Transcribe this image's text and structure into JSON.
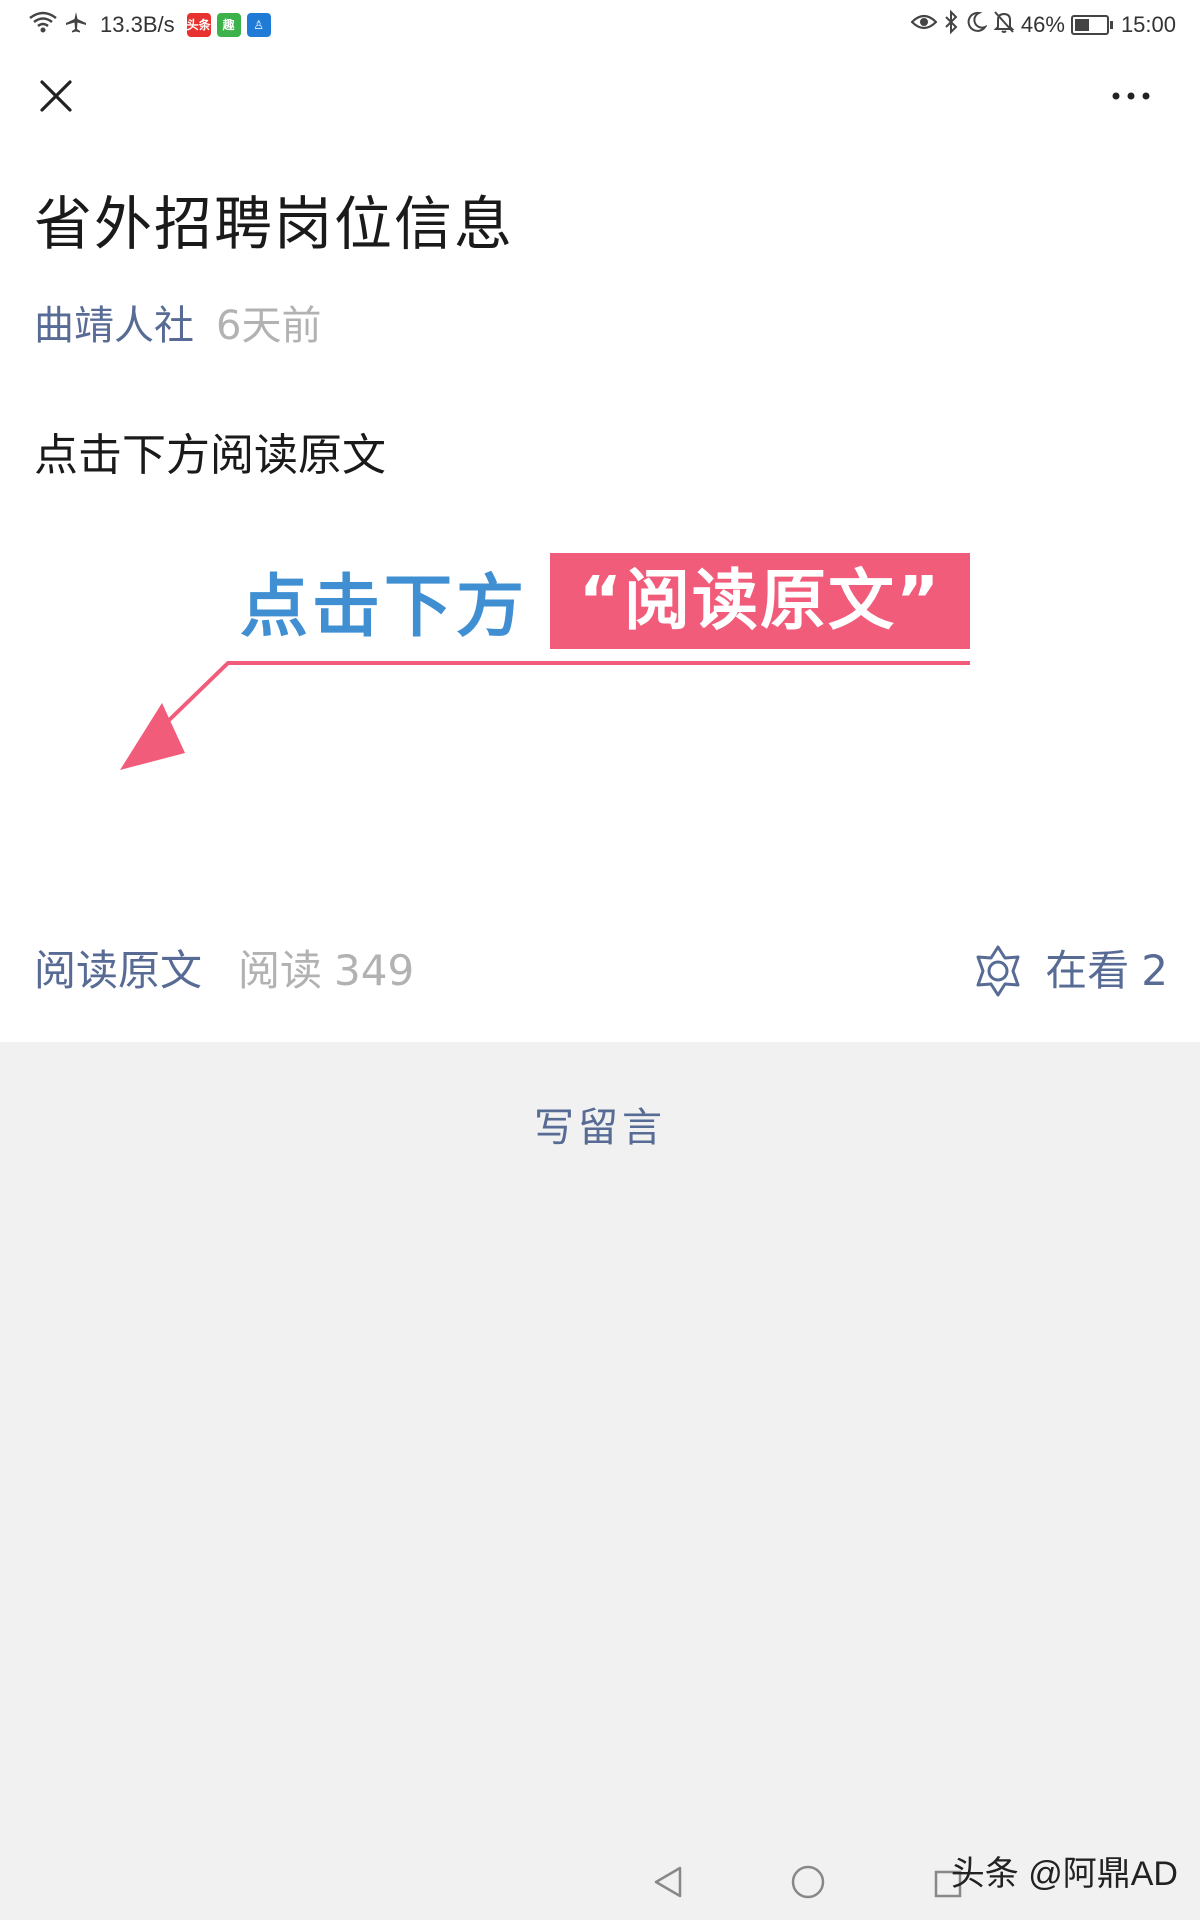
{
  "status_bar": {
    "net_speed": "13.3B/s",
    "battery": "46%",
    "battery_level": 0.46,
    "time": "15:00",
    "app_badges": [
      {
        "name": "toutiao-badge",
        "color": "#e8322f",
        "label": "头条"
      },
      {
        "name": "green-app-badge",
        "color": "#3bb24a",
        "label": "趣"
      },
      {
        "name": "blue-app-badge",
        "color": "#1f7bd6",
        "label": "♙"
      }
    ]
  },
  "nav": {
    "close_icon": "close-icon",
    "more_icon": "more-icon"
  },
  "article": {
    "title": "省外招聘岗位信息",
    "account": "曲靖人社",
    "time": "6天前",
    "body_text": "点击下方阅读原文"
  },
  "banner": {
    "blue_text": "点击下方",
    "pink_text": "“阅读原文”",
    "blue_color": "#3f8fd2",
    "pink_color": "#f15c7b"
  },
  "footer": {
    "read_more": "阅读原文",
    "read_label": "阅读",
    "read_count": "349",
    "like_label": "在看",
    "like_count": "2"
  },
  "comment": {
    "write_label": "写留言"
  },
  "watermark": "头条 @阿鼎AD",
  "colors": {
    "link": "#576b95",
    "muted": "#b2b2b2",
    "comment_bg": "#f1f1f1"
  }
}
